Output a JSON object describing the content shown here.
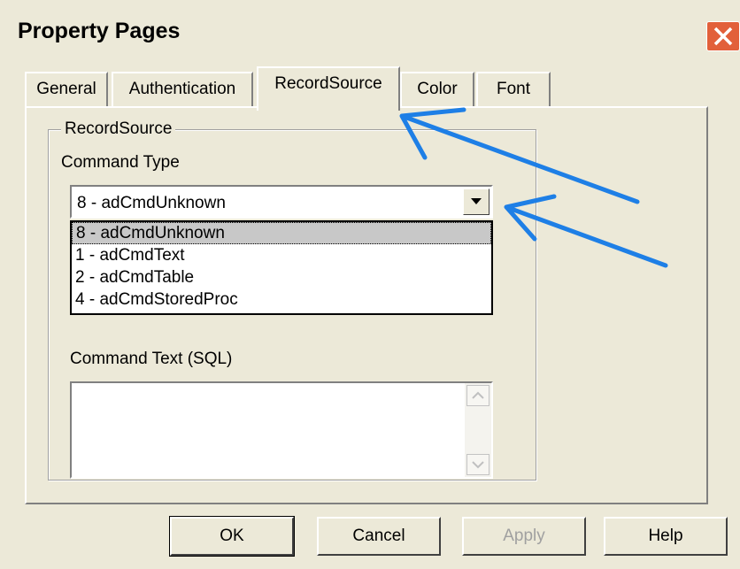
{
  "window": {
    "title": "Property Pages"
  },
  "tabs": [
    {
      "label": "General"
    },
    {
      "label": "Authentication"
    },
    {
      "label": "RecordSource"
    },
    {
      "label": "Color"
    },
    {
      "label": "Font"
    }
  ],
  "active_tab": "RecordSource",
  "group": {
    "legend": "RecordSource",
    "command_type_label": "Command Type",
    "combo_value": "8 - adCmdUnknown",
    "options": [
      "8 - adCmdUnknown",
      "1 - adCmdText",
      "2 - adCmdTable",
      "4 - adCmdStoredProc"
    ],
    "command_text_label": "Command Text (SQL)",
    "command_text_value": ""
  },
  "buttons": {
    "ok": "OK",
    "cancel": "Cancel",
    "apply": "Apply",
    "help": "Help"
  },
  "colors": {
    "annotation": "#1e7fe6",
    "close": "#e2603a",
    "face": "#ece9d8"
  },
  "icons": [
    "close-icon",
    "dropdown-arrow-icon",
    "scroll-up-icon",
    "scroll-down-icon"
  ]
}
